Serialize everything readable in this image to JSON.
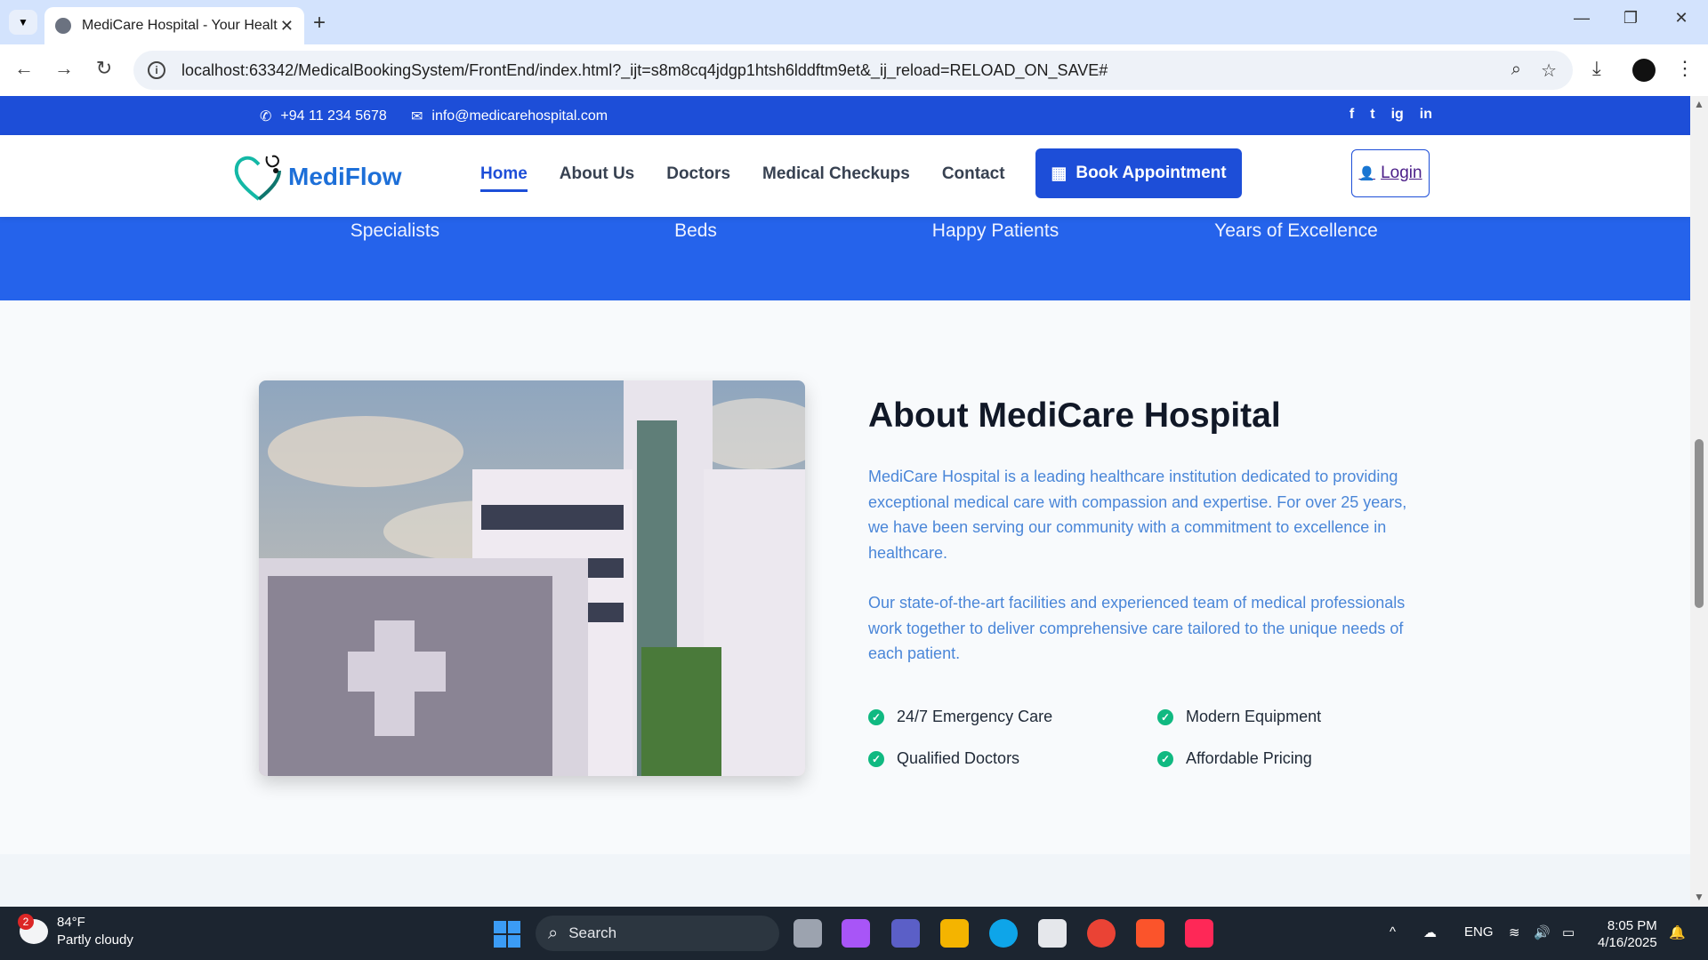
{
  "browser": {
    "tab_title": "MediCare Hospital - Your Healt",
    "url": "localhost:63342/MedicalBookingSystem/FrontEnd/index.html?_ijt=s8m8cq4jdgp1htsh6lddftm9et&_ij_reload=RELOAD_ON_SAVE#"
  },
  "topbar": {
    "phone": "+94 11 234 5678",
    "email": "info@medicarehospital.com",
    "social": [
      "f",
      "t",
      "ig",
      "in"
    ]
  },
  "header": {
    "brand": "MediFlow",
    "nav": [
      "Home",
      "About Us",
      "Doctors",
      "Medical Checkups",
      "Contact"
    ],
    "active_nav": "Home",
    "book_label": "Book Appointment",
    "login_label": "Login"
  },
  "stats": [
    "Specialists",
    "Beds",
    "Happy Patients",
    "Years of Excellence"
  ],
  "about": {
    "title": "About MediCare Hospital",
    "para1": "MediCare Hospital is a leading healthcare institution dedicated to providing exceptional medical care with compassion and expertise. For over 25 years, we have been serving our community with a commitment to excellence in healthcare.",
    "para2": "Our state-of-the-art facilities and experienced team of medical professionals work together to deliver comprehensive care tailored to the unique needs of each patient.",
    "features": [
      "24/7 Emergency Care",
      "Modern Equipment",
      "Qualified Doctors",
      "Affordable Pricing"
    ]
  },
  "taskbar": {
    "weather_badge": "2",
    "temperature": "84°F",
    "condition": "Partly cloudy",
    "search_label": "Search",
    "lang": "ENG",
    "time": "8:05 PM",
    "date": "4/16/2025"
  },
  "colors": {
    "primary": "#1d4ed8",
    "stats_bg": "#2563eb",
    "paragraph": "#4a86d8",
    "check": "#10b981"
  }
}
